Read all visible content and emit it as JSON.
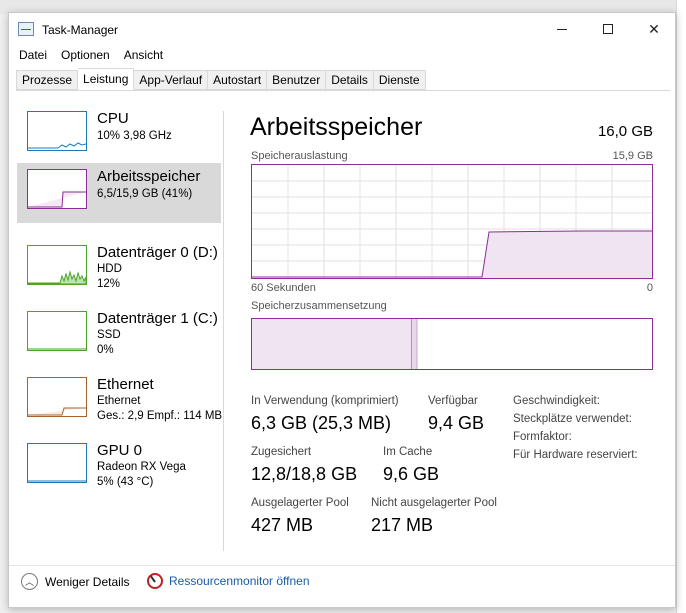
{
  "window": {
    "title": "Task-Manager"
  },
  "menu": [
    "Datei",
    "Optionen",
    "Ansicht"
  ],
  "tabs": [
    "Prozesse",
    "Leistung",
    "App-Verlauf",
    "Autostart",
    "Benutzer",
    "Details",
    "Dienste"
  ],
  "active_tab": "Leistung",
  "side": [
    {
      "name": "CPU",
      "sub1": "10% 3,98 GHz",
      "sub2": "",
      "color": "#1b7bb8"
    },
    {
      "name": "Arbeitsspeicher",
      "sub1": "6,5/15,9 GB (41%)",
      "sub2": "",
      "color": "#8b2d92"
    },
    {
      "name": "Datenträger 0 (D:)",
      "sub1": "HDD",
      "sub2": "12%",
      "color": "#4ca32a"
    },
    {
      "name": "Datenträger 1 (C:)",
      "sub1": "SSD",
      "sub2": "0%",
      "color": "#4ca32a"
    },
    {
      "name": "Ethernet",
      "sub1": "Ethernet",
      "sub2": "Ges.: 2,9 Empf.: 114 MB",
      "color": "#a7632a"
    },
    {
      "name": "GPU 0",
      "sub1": "Radeon RX Vega",
      "sub2": "5% (43 °C)",
      "color": "#1b7bb8"
    }
  ],
  "main": {
    "title": "Arbeitsspeicher",
    "total": "16,0 GB",
    "usage_label": "Speicherauslastung",
    "usage_max": "15,9 GB",
    "axis_left": "60 Sekunden",
    "axis_right": "0",
    "composition_label": "Speicherzusammensetzung",
    "accent": "#8b2d92"
  },
  "stats": {
    "in_use_label": "In Verwendung (komprimiert)",
    "in_use_value": "6,3 GB (25,3 MB)",
    "available_label": "Verfügbar",
    "available_value": "9,4 GB",
    "committed_label": "Zugesichert",
    "committed_value": "12,8/18,8 GB",
    "cached_label": "Im Cache",
    "cached_value": "9,6 GB",
    "paged_label": "Ausgelagerter Pool",
    "paged_value": "427 MB",
    "nonpaged_label": "Nicht ausgelagerter Pool",
    "nonpaged_value": "217 MB",
    "speed_label": "Geschwindigkeit:",
    "slots_label": "Steckplätze verwendet:",
    "form_label": "Formfaktor:",
    "reserved_label": "Für Hardware reserviert:"
  },
  "footer": {
    "less_details": "Weniger Details",
    "resource_monitor": "Ressourcenmonitor öffnen"
  }
}
